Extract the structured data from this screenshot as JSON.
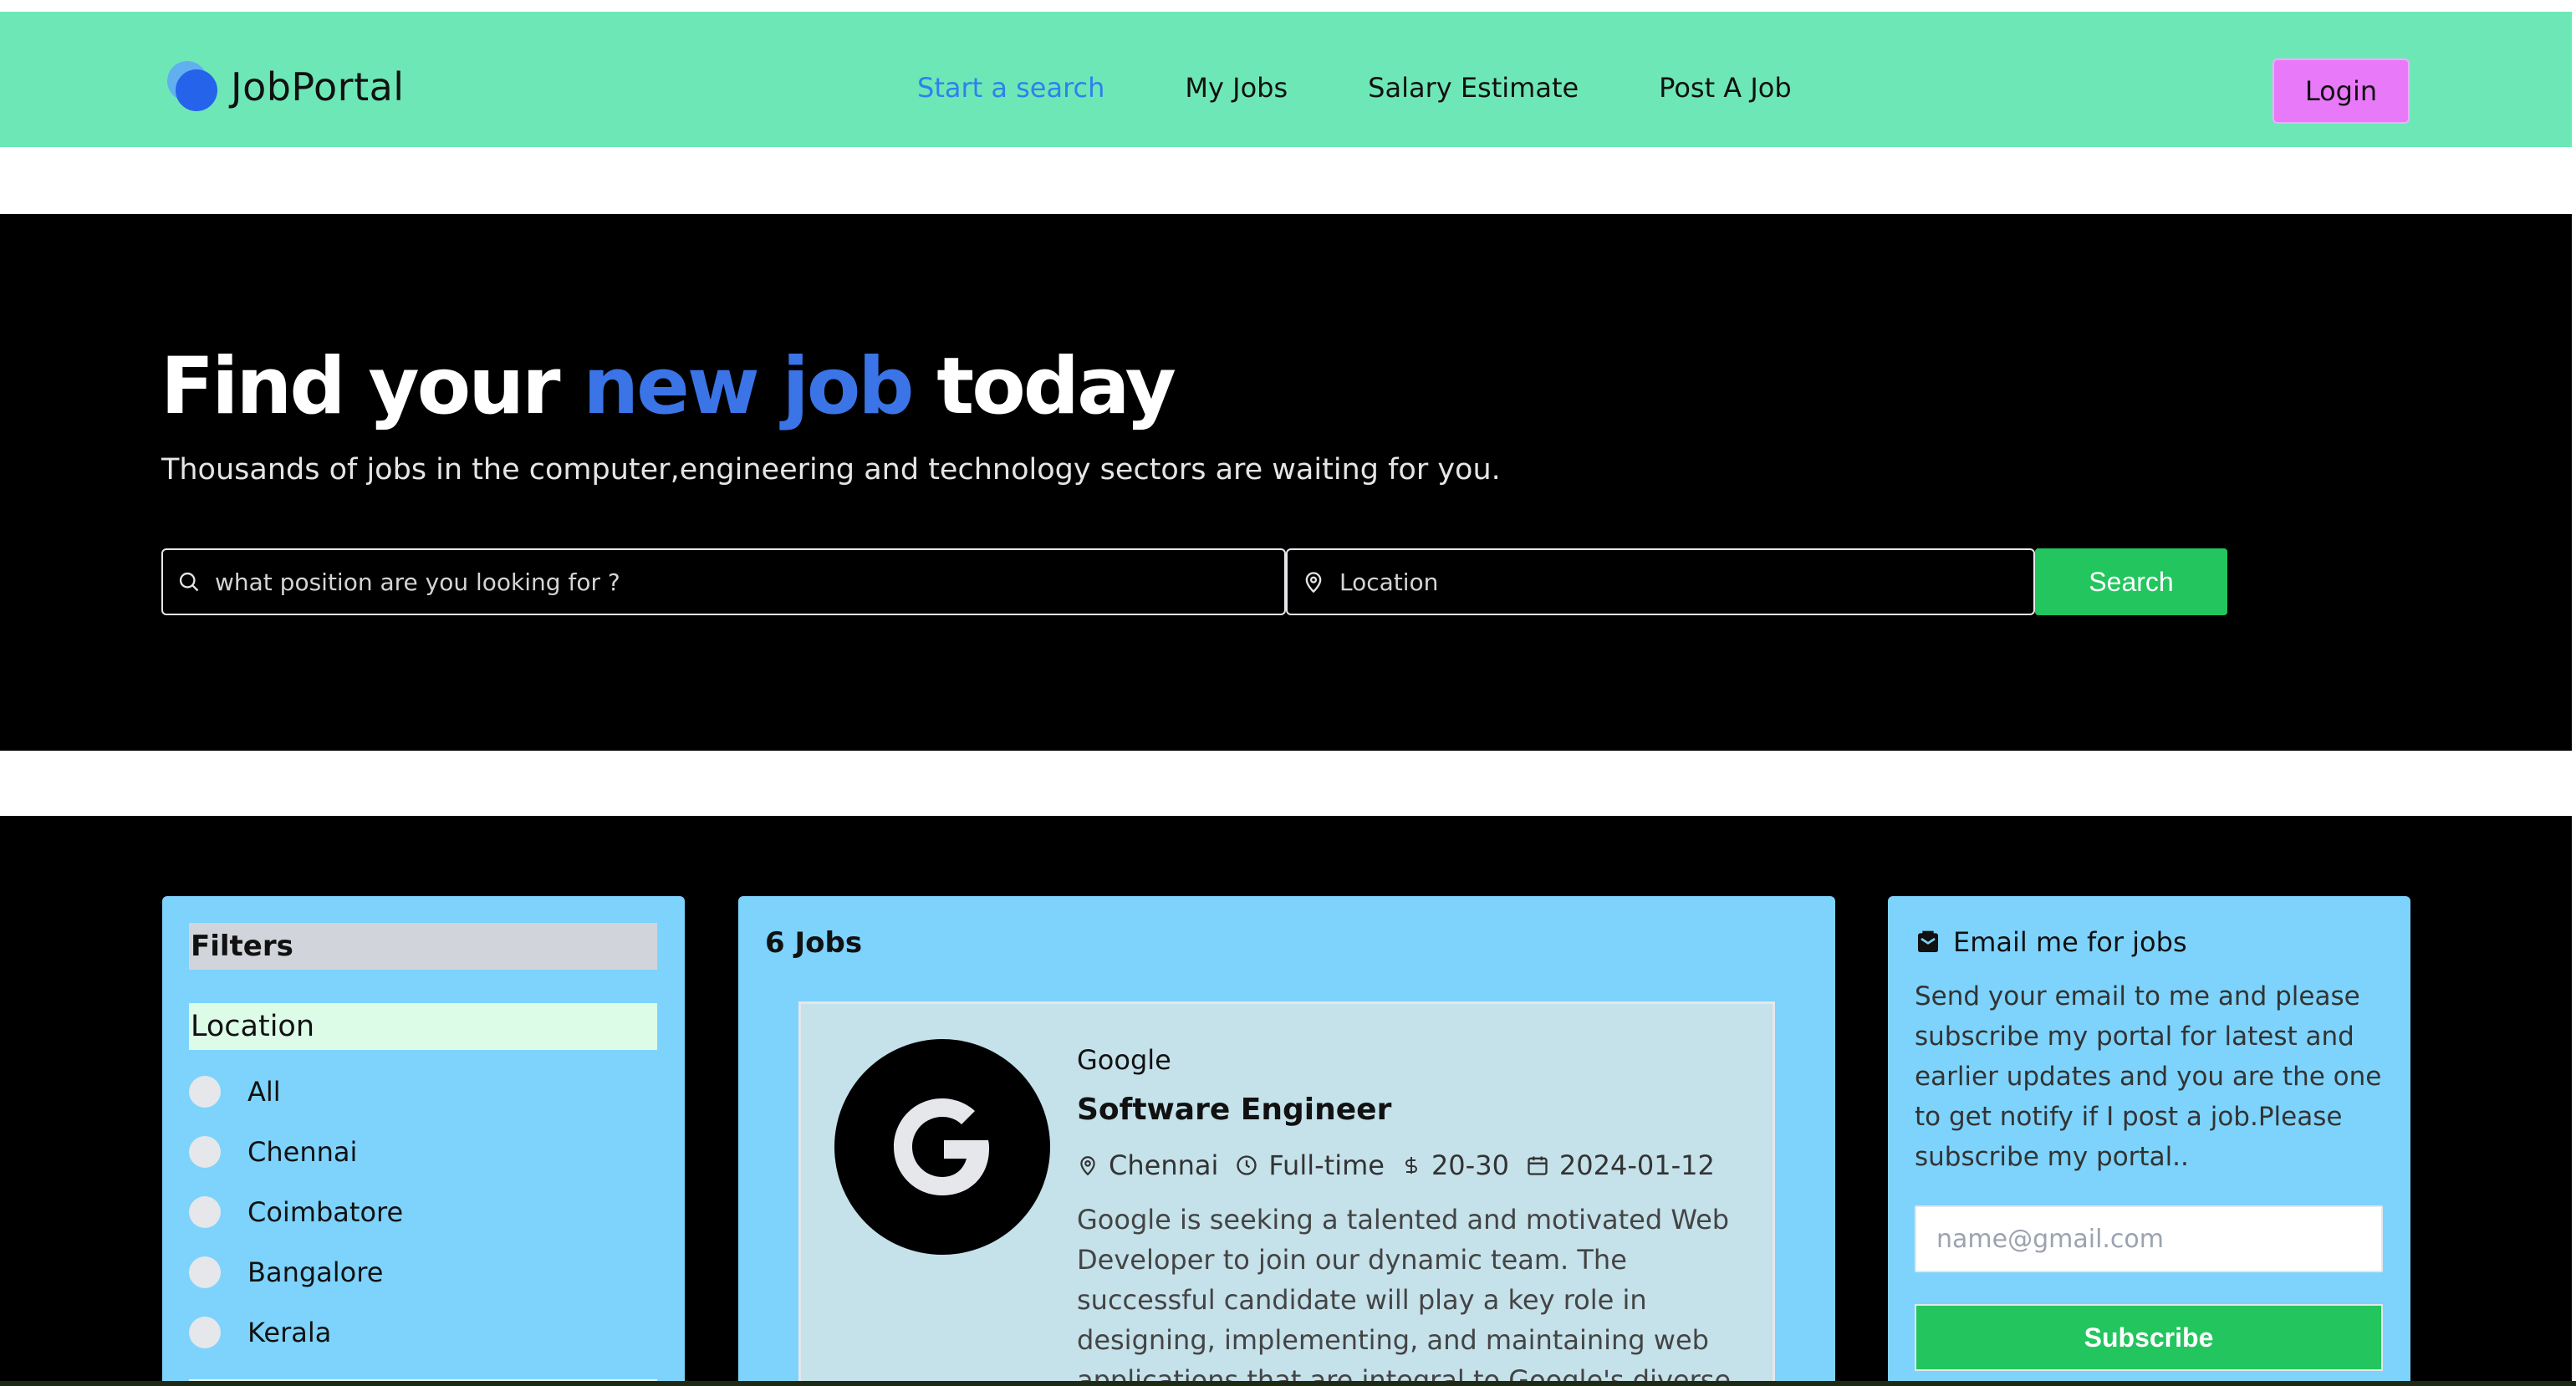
{
  "navbar": {
    "brand": "JobPortal",
    "links": [
      {
        "label": "Start a search",
        "active": true
      },
      {
        "label": "My Jobs"
      },
      {
        "label": "Salary Estimate"
      },
      {
        "label": "Post A Job"
      }
    ],
    "login": "Login"
  },
  "hero": {
    "title_start": "Find your ",
    "title_accent": "new job",
    "title_end": " today",
    "subtitle": "Thousands of jobs in the computer,engineering and technology sectors are waiting for you.",
    "position_placeholder": "what position are you looking for ?",
    "location_placeholder": "Location",
    "search_button": "Search"
  },
  "filters": {
    "heading": "Filters",
    "location_heading": "Location",
    "locations": [
      "All",
      "Chennai",
      "Coimbatore",
      "Bangalore",
      "Kerala"
    ]
  },
  "jobs": {
    "count_label": "6 Jobs",
    "card": {
      "company": "Google",
      "title": "Software Engineer",
      "location": "Chennai",
      "type": "Full-time",
      "salary": "20-30",
      "date": "2024-01-12",
      "description": "Google is seeking a talented and motivated Web Developer to join our dynamic team. The successful candidate will play a key role in designing, implementing, and maintaining web applications that are integral to Google's diverse portfolio of products."
    }
  },
  "email": {
    "heading": "Email me for jobs",
    "text": "Send your email to me and please subscribe my portal for latest and earlier updates and you are the one to get notify if I post a job.Please subscribe my portal..",
    "placeholder": "name@gmail.com",
    "button": "Subscribe"
  },
  "colors": {
    "navbar_bg": "#6ee7b7",
    "accent_blue": "#3b74e6",
    "login_bg": "#e879f9",
    "button_green": "#22c55e",
    "panel_bg": "#7dd3fc"
  }
}
